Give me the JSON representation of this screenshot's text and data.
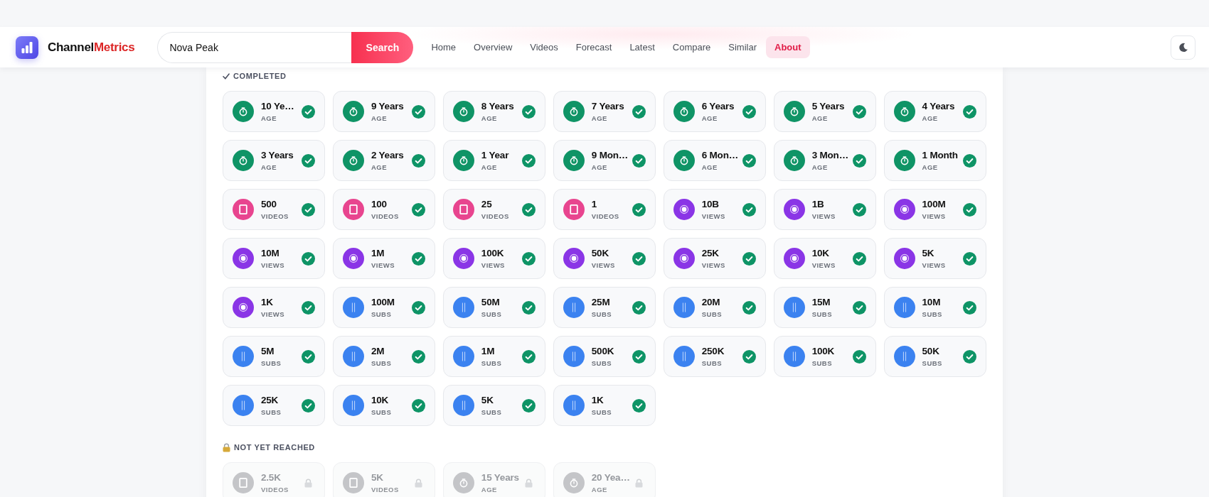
{
  "header": {
    "brand": {
      "name": "Channel",
      "accent": "Metrics"
    },
    "search": {
      "value": "Nova Peak",
      "button": "Search"
    },
    "nav": [
      {
        "label": "Home",
        "selected": false
      },
      {
        "label": "Overview",
        "selected": false
      },
      {
        "label": "Videos",
        "selected": false
      },
      {
        "label": "Forecast",
        "selected": false
      },
      {
        "label": "Latest",
        "selected": false
      },
      {
        "label": "Compare",
        "selected": false
      },
      {
        "label": "Similar",
        "selected": false
      },
      {
        "label": "About",
        "selected": true
      }
    ]
  },
  "sections": [
    {
      "kind": "completed",
      "heading": "COMPLETED",
      "milestones": [
        {
          "value": "10 Ye…",
          "label": "AGE",
          "kind": "age",
          "reached": true
        },
        {
          "value": "9 Years",
          "label": "AGE",
          "kind": "age",
          "reached": true
        },
        {
          "value": "8 Years",
          "label": "AGE",
          "kind": "age",
          "reached": true
        },
        {
          "value": "7 Years",
          "label": "AGE",
          "kind": "age",
          "reached": true
        },
        {
          "value": "6 Years",
          "label": "AGE",
          "kind": "age",
          "reached": true
        },
        {
          "value": "5 Years",
          "label": "AGE",
          "kind": "age",
          "reached": true
        },
        {
          "value": "4 Years",
          "label": "AGE",
          "kind": "age",
          "reached": true
        },
        {
          "value": "3 Years",
          "label": "AGE",
          "kind": "age",
          "reached": true
        },
        {
          "value": "2 Years",
          "label": "AGE",
          "kind": "age",
          "reached": true
        },
        {
          "value": "1 Year",
          "label": "AGE",
          "kind": "age",
          "reached": true
        },
        {
          "value": "9 Mon…",
          "label": "AGE",
          "kind": "age",
          "reached": true
        },
        {
          "value": "6 Mon…",
          "label": "AGE",
          "kind": "age",
          "reached": true
        },
        {
          "value": "3 Mon…",
          "label": "AGE",
          "kind": "age",
          "reached": true
        },
        {
          "value": "1 Month",
          "label": "AGE",
          "kind": "age",
          "reached": true
        },
        {
          "value": "500",
          "label": "VIDEOS",
          "kind": "videos",
          "reached": true
        },
        {
          "value": "100",
          "label": "VIDEOS",
          "kind": "videos",
          "reached": true
        },
        {
          "value": "25",
          "label": "VIDEOS",
          "kind": "videos",
          "reached": true
        },
        {
          "value": "1",
          "label": "VIDEOS",
          "kind": "videos",
          "reached": true
        },
        {
          "value": "10B",
          "label": "VIEWS",
          "kind": "views",
          "reached": true
        },
        {
          "value": "1B",
          "label": "VIEWS",
          "kind": "views",
          "reached": true
        },
        {
          "value": "100M",
          "label": "VIEWS",
          "kind": "views",
          "reached": true
        },
        {
          "value": "10M",
          "label": "VIEWS",
          "kind": "views",
          "reached": true
        },
        {
          "value": "1M",
          "label": "VIEWS",
          "kind": "views",
          "reached": true
        },
        {
          "value": "100K",
          "label": "VIEWS",
          "kind": "views",
          "reached": true
        },
        {
          "value": "50K",
          "label": "VIEWS",
          "kind": "views",
          "reached": true
        },
        {
          "value": "25K",
          "label": "VIEWS",
          "kind": "views",
          "reached": true
        },
        {
          "value": "10K",
          "label": "VIEWS",
          "kind": "views",
          "reached": true
        },
        {
          "value": "5K",
          "label": "VIEWS",
          "kind": "views",
          "reached": true
        },
        {
          "value": "1K",
          "label": "VIEWS",
          "kind": "views",
          "reached": true
        },
        {
          "value": "100M",
          "label": "SUBS",
          "kind": "subs",
          "reached": true
        },
        {
          "value": "50M",
          "label": "SUBS",
          "kind": "subs",
          "reached": true
        },
        {
          "value": "25M",
          "label": "SUBS",
          "kind": "subs",
          "reached": true
        },
        {
          "value": "20M",
          "label": "SUBS",
          "kind": "subs",
          "reached": true
        },
        {
          "value": "15M",
          "label": "SUBS",
          "kind": "subs",
          "reached": true
        },
        {
          "value": "10M",
          "label": "SUBS",
          "kind": "subs",
          "reached": true
        },
        {
          "value": "5M",
          "label": "SUBS",
          "kind": "subs",
          "reached": true
        },
        {
          "value": "2M",
          "label": "SUBS",
          "kind": "subs",
          "reached": true
        },
        {
          "value": "1M",
          "label": "SUBS",
          "kind": "subs",
          "reached": true
        },
        {
          "value": "500K",
          "label": "SUBS",
          "kind": "subs",
          "reached": true
        },
        {
          "value": "250K",
          "label": "SUBS",
          "kind": "subs",
          "reached": true
        },
        {
          "value": "100K",
          "label": "SUBS",
          "kind": "subs",
          "reached": true
        },
        {
          "value": "50K",
          "label": "SUBS",
          "kind": "subs",
          "reached": true
        },
        {
          "value": "25K",
          "label": "SUBS",
          "kind": "subs",
          "reached": true
        },
        {
          "value": "10K",
          "label": "SUBS",
          "kind": "subs",
          "reached": true
        },
        {
          "value": "5K",
          "label": "SUBS",
          "kind": "subs",
          "reached": true
        },
        {
          "value": "1K",
          "label": "SUBS",
          "kind": "subs",
          "reached": true
        }
      ]
    },
    {
      "kind": "locked",
      "heading": "NOT YET REACHED",
      "milestones": [
        {
          "value": "2.5K",
          "label": "VIDEOS",
          "kind": "videos",
          "reached": false
        },
        {
          "value": "5K",
          "label": "VIDEOS",
          "kind": "videos",
          "reached": false
        },
        {
          "value": "15 Years",
          "label": "AGE",
          "kind": "age",
          "reached": false
        },
        {
          "value": "20 Yea…",
          "label": "AGE",
          "kind": "age",
          "reached": false
        }
      ]
    }
  ]
}
